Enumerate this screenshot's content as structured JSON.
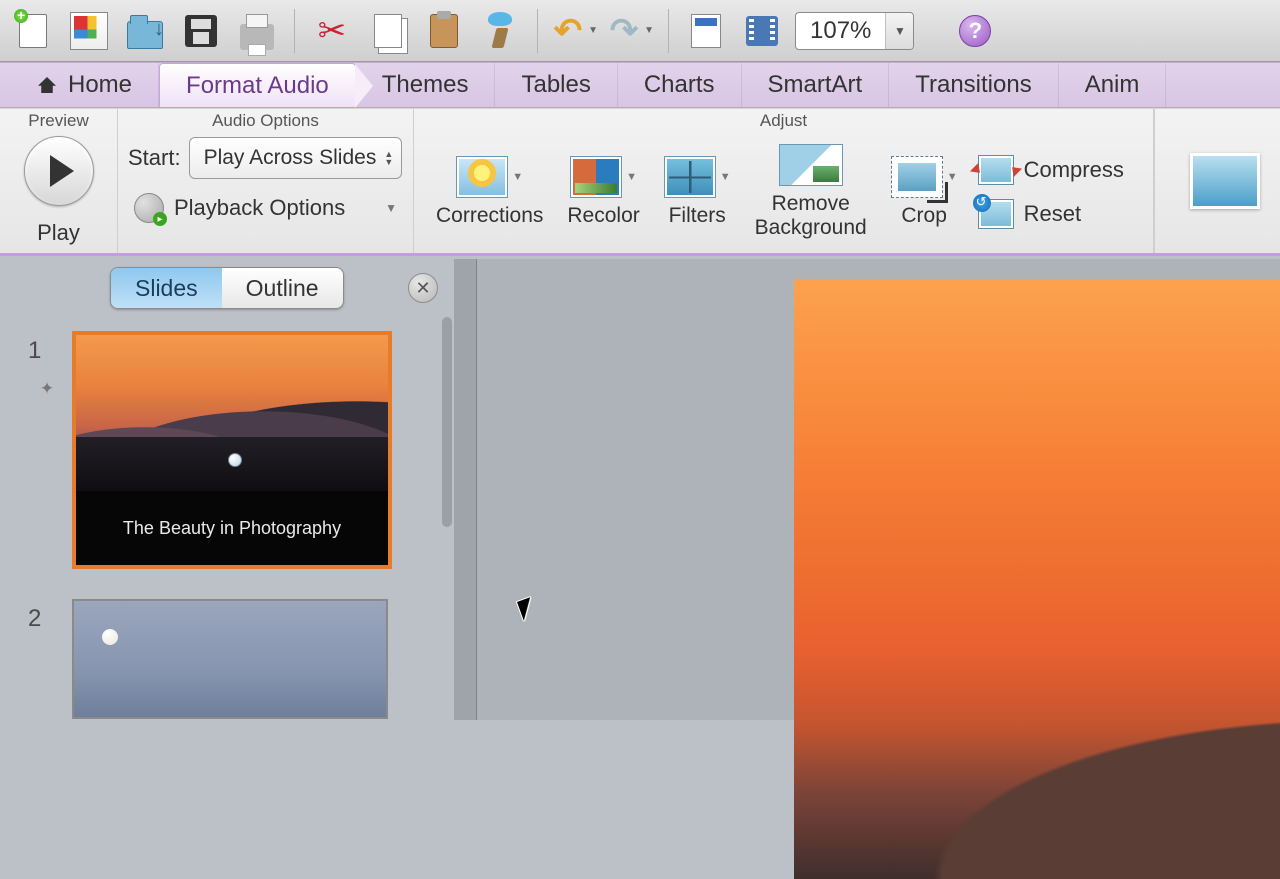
{
  "toolbar": {
    "zoom": "107%"
  },
  "tabs": {
    "home": "Home",
    "format_audio": "Format Audio",
    "themes": "Themes",
    "tables": "Tables",
    "charts": "Charts",
    "smartart": "SmartArt",
    "transitions": "Transitions",
    "animations": "Anim"
  },
  "ribbon": {
    "preview": {
      "title": "Preview",
      "play": "Play"
    },
    "audio_options": {
      "title": "Audio Options",
      "start_label": "Start:",
      "start_value": "Play Across Slides",
      "playback_options": "Playback Options"
    },
    "adjust": {
      "title": "Adjust",
      "corrections": "Corrections",
      "recolor": "Recolor",
      "filters": "Filters",
      "remove_background": "Remove\nBackground",
      "crop": "Crop",
      "compress": "Compress",
      "reset": "Reset"
    }
  },
  "panel": {
    "slides_tab": "Slides",
    "outline_tab": "Outline",
    "slides": [
      {
        "number": "1",
        "title": "The Beauty in Photography"
      },
      {
        "number": "2",
        "title": ""
      }
    ]
  }
}
